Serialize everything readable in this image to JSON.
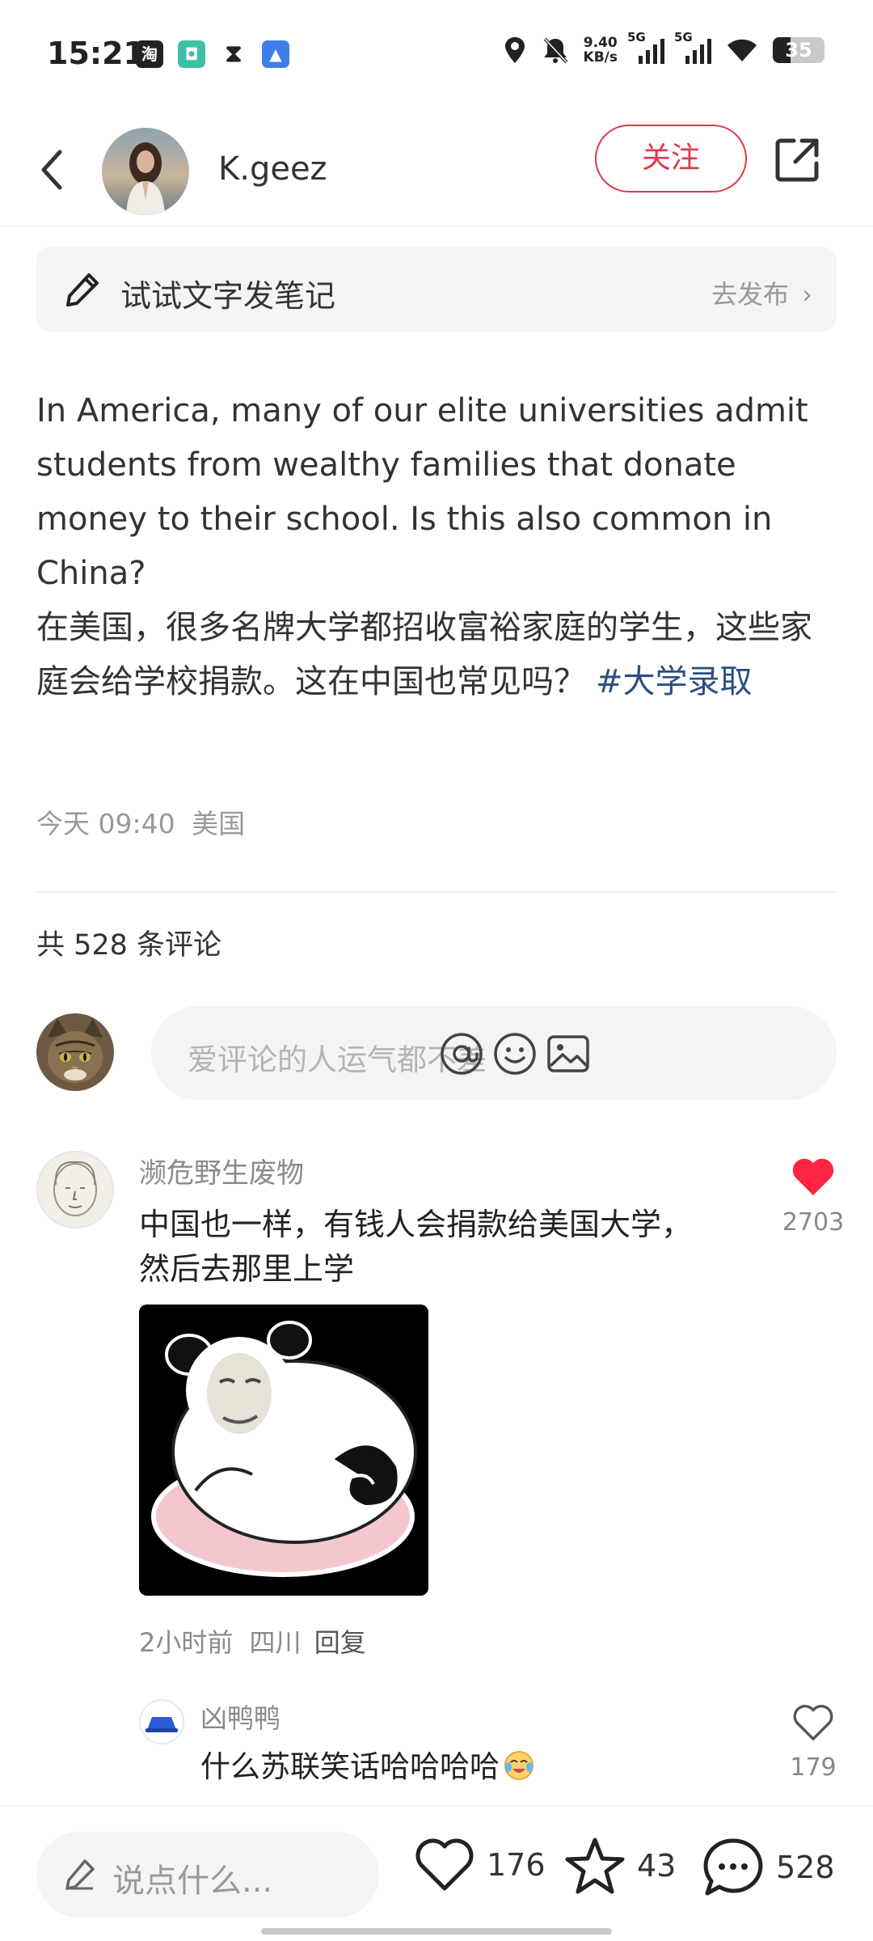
{
  "status_bar": {
    "time": "15:21",
    "apps": [
      "taobao-icon",
      "app-icon",
      "hourglass-icon",
      "app-icon"
    ],
    "net_speed_value": "9.40",
    "net_speed_unit": "KB/s",
    "sim1_label": "5G",
    "sim2_label": "5G",
    "battery": "35"
  },
  "header": {
    "author_name": "K.geez",
    "follow_label": "关注"
  },
  "compose_banner": {
    "label": "试试文字发笔记",
    "action": "去发布"
  },
  "post": {
    "text_en": "In America, many of our elite universities admit students from wealthy families that donate money to their school. Is this also common in China?",
    "text_zh": "在美国，很多名牌大学都招收富裕家庭的学生，这些家庭会给学校捐款。这在中国也常见吗？",
    "hashtag": "#大学录取",
    "date": "今天 09:40",
    "location": "美国"
  },
  "comments_header": {
    "count_label": "共 528 条评论"
  },
  "comment_input": {
    "placeholder": "爱评论的人运气都不差"
  },
  "comments": [
    {
      "user": "濒危野生废物",
      "text": "中国也一样，有钱人会捐款给美国大学，然后去那里上学",
      "likes": "2703",
      "liked": true,
      "time": "2小时前",
      "location": "四川",
      "reply_label": "回复",
      "replies": [
        {
          "user": "凶鸭鸭",
          "text": "什么苏联笑话哈哈哈哈",
          "likes": "179",
          "liked": false
        }
      ]
    }
  ],
  "bottom_bar": {
    "placeholder": "说点什么...",
    "likes": "176",
    "favorites": "43",
    "comments": "528"
  },
  "colors": {
    "accent": "#e0384c",
    "hashtag": "#2b4f7f",
    "like_red": "#ff2442",
    "muted": "#999999"
  }
}
